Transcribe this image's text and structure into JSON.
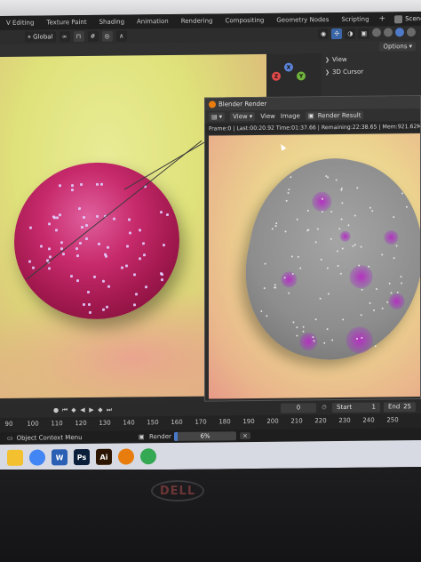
{
  "topbar": {
    "tabs": [
      "V Editing",
      "Texture Paint",
      "Shading",
      "Animation",
      "Rendering",
      "Compositing",
      "Geometry Nodes",
      "Scripting"
    ],
    "add_tab": "+",
    "scene": "Scene"
  },
  "toolbar": {
    "transform_orientation": "Global",
    "options": "Options"
  },
  "outliner": {
    "items": [
      "View",
      "3D Cursor"
    ]
  },
  "gizmo": {
    "x": "X",
    "y": "Y",
    "z": "Z"
  },
  "render_window": {
    "title": "Blender Render",
    "menu_view_selector": "View",
    "menu_view": "View",
    "menu_image": "Image",
    "result_label": "Render Result",
    "status": "Frame:0 | Last:00:20.92 Time:01:37.66 | Remaining:22:38.65 | Mem:921.62M, Pe"
  },
  "timeline": {
    "current_frame": "0",
    "start_label": "Start",
    "start_value": "1",
    "end_label": "End",
    "end_value": "25"
  },
  "ruler": {
    "ticks": [
      "90",
      "100",
      "110",
      "120",
      "130",
      "140",
      "150",
      "160",
      "170",
      "180",
      "190",
      "200",
      "210",
      "220",
      "230",
      "240",
      "250"
    ]
  },
  "statusbar": {
    "context_menu": "Object Context Menu",
    "render_label": "Render",
    "progress_text": "6%",
    "progress_value": 0.06,
    "close": "×"
  },
  "taskbar": {
    "apps": [
      {
        "name": "file-explorer",
        "glyph": "",
        "color": "#f3c030"
      },
      {
        "name": "chrome",
        "glyph": "",
        "color": "#4285f4"
      },
      {
        "name": "word",
        "glyph": "W",
        "color": "#2b5fb4"
      },
      {
        "name": "photoshop",
        "glyph": "Ps",
        "color": "#0b1f3a"
      },
      {
        "name": "illustrator",
        "glyph": "Ai",
        "color": "#2c1500"
      },
      {
        "name": "blender",
        "glyph": "",
        "color": "#e87d0d"
      },
      {
        "name": "chrome-2",
        "glyph": "",
        "color": "#34a853"
      }
    ]
  },
  "brand": "DELL",
  "colors": {
    "accent_blue": "#4a79c9",
    "blender_orange": "#e87d0d",
    "sphere_magenta": "#c72a6b"
  }
}
